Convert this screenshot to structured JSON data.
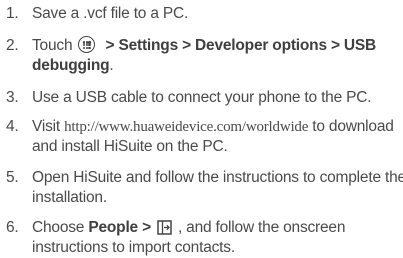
{
  "steps": [
    {
      "number": "1.",
      "text": "Save a .vcf file to a PC."
    },
    {
      "number": "2.",
      "prefix": "Touch",
      "icon": "menu-icon",
      "path_bold_1": " > Settings > Developer options > USB",
      "path_bold_2": "debugging",
      "suffix": "."
    },
    {
      "number": "3.",
      "text": "Use a USB cable to connect your phone to the PC."
    },
    {
      "number": "4.",
      "prefix": "Visit ",
      "url": "http://www.huaweidevice.com/worldwide",
      "after_url": " to download",
      "line2": "and install HiSuite on the PC."
    },
    {
      "number": "5.",
      "line1": "Open HiSuite and follow the instructions to complete the",
      "line2": "installation."
    },
    {
      "number": "6.",
      "prefix": "Choose ",
      "bold": "People >",
      "icon": "import-icon",
      "after_icon": ", and follow the onscreen",
      "line2": "instructions to import contacts."
    }
  ]
}
